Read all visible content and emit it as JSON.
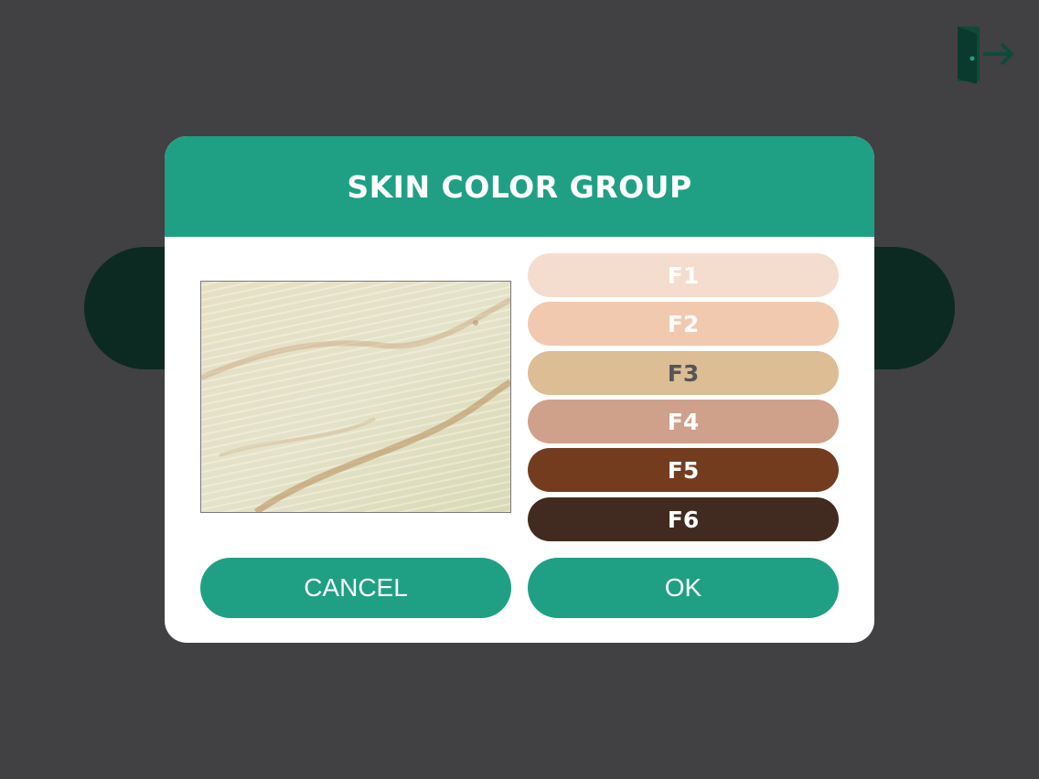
{
  "app": {
    "accent_color": "#1fa085",
    "background_color": "#414042",
    "exit_icon": "exit-door-icon"
  },
  "dialog": {
    "title": "SKIN COLOR GROUP",
    "preview_icon": "skin-image-preview",
    "swatches": [
      {
        "label": "F1",
        "color": "#f4ddcf",
        "text_color": "#ffffff"
      },
      {
        "label": "F2",
        "color": "#f1c9af",
        "text_color": "#ffffff"
      },
      {
        "label": "F3",
        "color": "#dcbd94",
        "text_color": "#555555"
      },
      {
        "label": "F4",
        "color": "#cfa08a",
        "text_color": "#ffffff"
      },
      {
        "label": "F5",
        "color": "#743c1f",
        "text_color": "#ffffff"
      },
      {
        "label": "F6",
        "color": "#412a1f",
        "text_color": "#ffffff"
      }
    ],
    "buttons": {
      "cancel": "CANCEL",
      "ok": "OK"
    }
  }
}
